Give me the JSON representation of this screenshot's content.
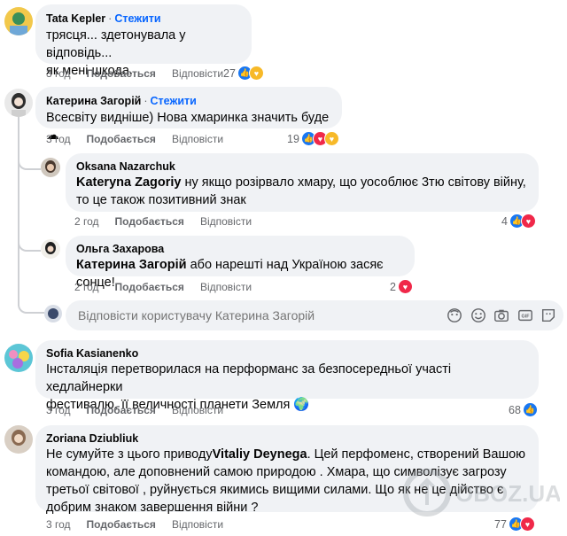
{
  "comments": [
    {
      "author": "Tata Kepler",
      "follow": "Стежити",
      "lines": [
        "трясця... здетонувала у відповідь...",
        "як мені шкода."
      ],
      "time": "3 год",
      "like": "Подобається",
      "reply": "Відповісти",
      "reactions": "27"
    },
    {
      "author": "Катерина Загорій",
      "follow": "Стежити",
      "text": "Всесвіту видніше) Нова хмаринка значить буде",
      "time": "3 год",
      "like": "Подобається",
      "reply": "Відповісти",
      "reactions": "19"
    },
    {
      "author": "Oksana Nazarchuk",
      "mention": "Kateryna Zagoriy",
      "text_line1": " ну якщо розірвало хмару, що уособлює 3тю світову війну,",
      "text_line2": "то це також позитивний знак",
      "time": "2 год",
      "like": "Подобається",
      "reply": "Відповісти",
      "reactions": "4"
    },
    {
      "author": "Ольга Захарова",
      "mention": "Катерина Загорій",
      "text": " або нарешті над Україною засяє сонце!",
      "time": "2 год",
      "like": "Подобається",
      "reply": "Відповісти",
      "reactions": "2"
    },
    {
      "author": "Sofia Kasianenko",
      "lines": [
        "Інсталяція перетворилася на перформанс за безпосередньої участі хедлайнерки",
        "фестивалю, її величності планети Земля"
      ],
      "time": "3 год",
      "like": "Подобається",
      "reply": "Відповісти",
      "reactions": "68"
    },
    {
      "author": "Zoriana Dziubliuk",
      "line1_pre": "Не сумуйте з цього приводу",
      "mention": "Vitaliy Deynega",
      "line1_post": ". Цей перфоменс, створений Вашою",
      "lines": [
        "командою, але доповнений самою природою . Хмара, що символізує загрозу",
        "третьої світової , руйнується якимись вищими силами. Що як не це дійство є",
        "добрим знаком завершення війни ?"
      ],
      "time": "3 год",
      "like": "Подобається",
      "reply": "Відповісти",
      "reactions": "77"
    }
  ],
  "reply_box": {
    "placeholder": "Відповісти користувачу Катерина Загорій"
  },
  "watermark": "OBOZ.UA",
  "colors": {
    "like": "#1877f2",
    "love": "#f02849",
    "care": "#f7b928",
    "link": "#0866ff",
    "bubble": "#f0f2f5"
  }
}
